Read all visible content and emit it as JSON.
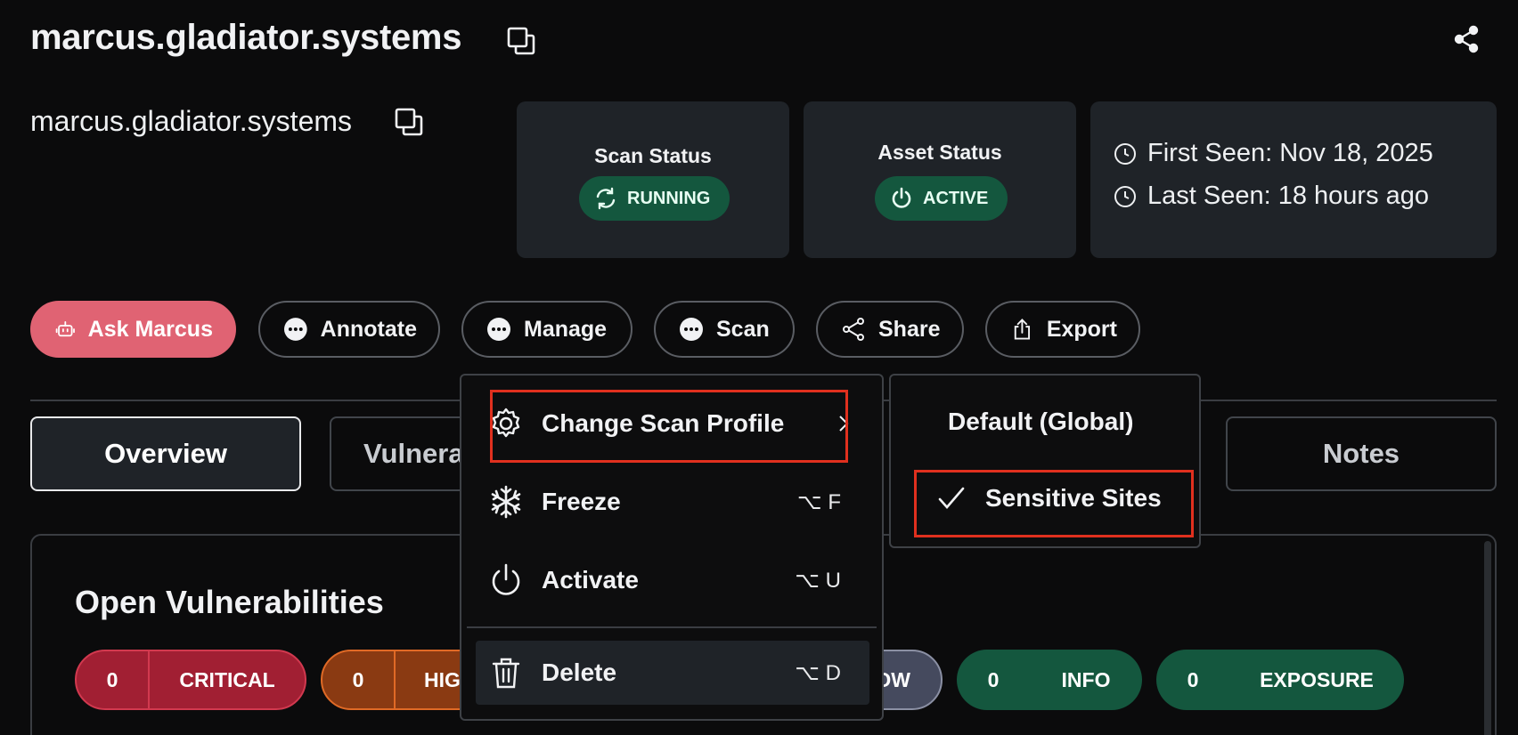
{
  "header": {
    "title": "marcus.gladiator.systems",
    "subtitle": "marcus.gladiator.systems"
  },
  "status_cards": {
    "scan_status": {
      "label": "Scan Status",
      "value": "RUNNING"
    },
    "asset_status": {
      "label": "Asset Status",
      "value": "ACTIVE"
    },
    "seen": {
      "first_seen": "First Seen: Nov 18, 2025",
      "last_seen": "Last Seen: 18 hours ago"
    }
  },
  "actions": {
    "ask": "Ask Marcus",
    "annotate": "Annotate",
    "manage": "Manage",
    "scan": "Scan",
    "share": "Share",
    "export": "Export"
  },
  "tabs": {
    "overview": "Overview",
    "vulnerabilities": "Vulnerabilities",
    "notes": "Notes"
  },
  "vulns": {
    "title": "Open Vulnerabilities",
    "critical": {
      "count": "0",
      "label": "CRITICAL"
    },
    "high": {
      "count": "0",
      "label": "HIGH"
    },
    "low": {
      "label": "LOW"
    },
    "info": {
      "count": "0",
      "label": "INFO"
    },
    "exposure": {
      "count": "0",
      "label": "EXPOSURE"
    }
  },
  "menu": {
    "change_profile": "Change Scan Profile",
    "freeze": "Freeze",
    "freeze_kbd": "⌥ F",
    "activate": "Activate",
    "activate_kbd": "⌥ U",
    "delete": "Delete",
    "delete_kbd": "⌥ D"
  },
  "submenu": {
    "default_global": "Default (Global)",
    "sensitive_sites": "Sensitive Sites"
  },
  "colors": {
    "background": "#0b0b0c",
    "card": "#1f2328",
    "accent": "#e06373",
    "status_green": "#14573e",
    "critical": "#a11f33",
    "high": "#8a3a12",
    "highlight_outline": "#e0301e"
  }
}
